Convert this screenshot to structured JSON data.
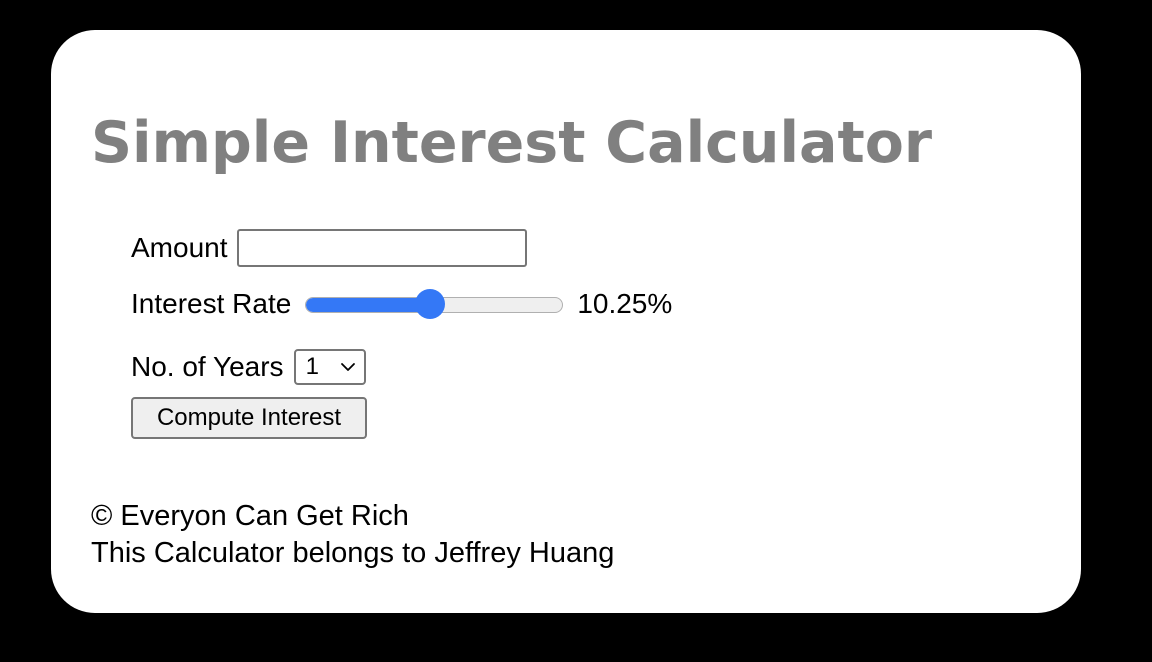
{
  "title": "Simple Interest Calculator",
  "form": {
    "amount_label": "Amount",
    "amount_value": "",
    "rate_label": "Interest Rate",
    "rate_value_text": "10.25%",
    "rate_slider_fraction": 0.49,
    "years_label": "No. of Years",
    "years_selected": "1",
    "compute_button_label": "Compute Interest"
  },
  "footer": {
    "copyright": "© Everyon Can Get Rich",
    "owner_line": "This Calculator belongs to Jeffrey Huang"
  },
  "colors": {
    "background": "#000000",
    "card": "#ffffff",
    "title": "#808080",
    "accent": "#3478f6"
  },
  "icons": {
    "select_arrow": "chevron-down-icon"
  }
}
